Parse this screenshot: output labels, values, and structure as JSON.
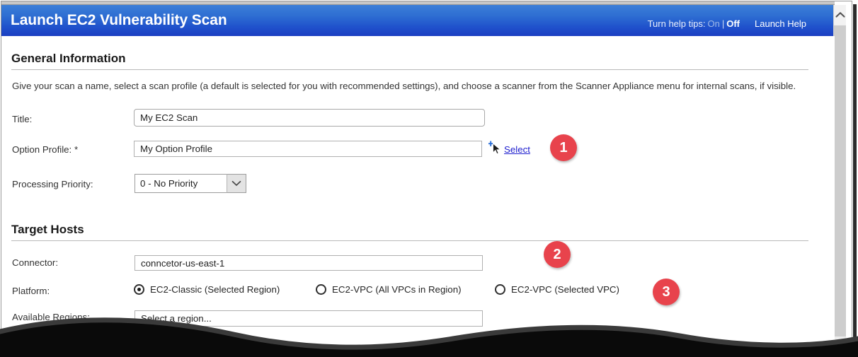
{
  "window": {
    "title": "Launch EC2 Vulnerability Scan",
    "help_tips_label": "Turn help tips:",
    "help_tips_on": "On",
    "help_tips_separator": "|",
    "help_tips_off": "Off",
    "launch_help": "Launch Help",
    "scroll_up_icon": "chevron-up-icon",
    "accent_header_top": "#3c7fd8",
    "accent_header_bottom": "#1b3fc2",
    "badge_color": "#e8434c",
    "link_color": "#2020cf"
  },
  "general_information": {
    "heading": "General Information",
    "description": "Give your scan a name, select a scan profile (a default is selected for you with recommended settings), and choose a scanner from the Scanner Appliance menu for internal scans, if visible.",
    "title_label": "Title:",
    "title_value": "My EC2 Scan",
    "title_placeholder": "",
    "option_profile_label": "Option Profile: *",
    "option_profile_value": "My Option Profile",
    "option_profile_placeholder": "",
    "select_link": "Select",
    "select_link_icon": "add-cursor-icon",
    "processing_priority_label": "Processing Priority:",
    "processing_priority_value": "0 - No Priority",
    "processing_priority_options": [
      "0 - No Priority"
    ],
    "dropdown_icon": "chevron-down-icon"
  },
  "target_hosts": {
    "heading": "Target Hosts",
    "connector_label": "Connector:",
    "connector_value": "conncetor-us-east-1",
    "connector_placeholder": "",
    "platform_label": "Platform:",
    "platform_options": [
      {
        "label": "EC2-Classic (Selected Region)",
        "selected": true
      },
      {
        "label": "EC2-VPC (All VPCs in Region)",
        "selected": false
      },
      {
        "label": "EC2-VPC (Selected VPC)",
        "selected": false
      }
    ],
    "available_regions_label": "Available Regions:",
    "available_regions_value": "Select a region...",
    "available_regions_placeholder": "Select a region..."
  },
  "callouts": [
    {
      "number": "1"
    },
    {
      "number": "2"
    },
    {
      "number": "3"
    }
  ]
}
